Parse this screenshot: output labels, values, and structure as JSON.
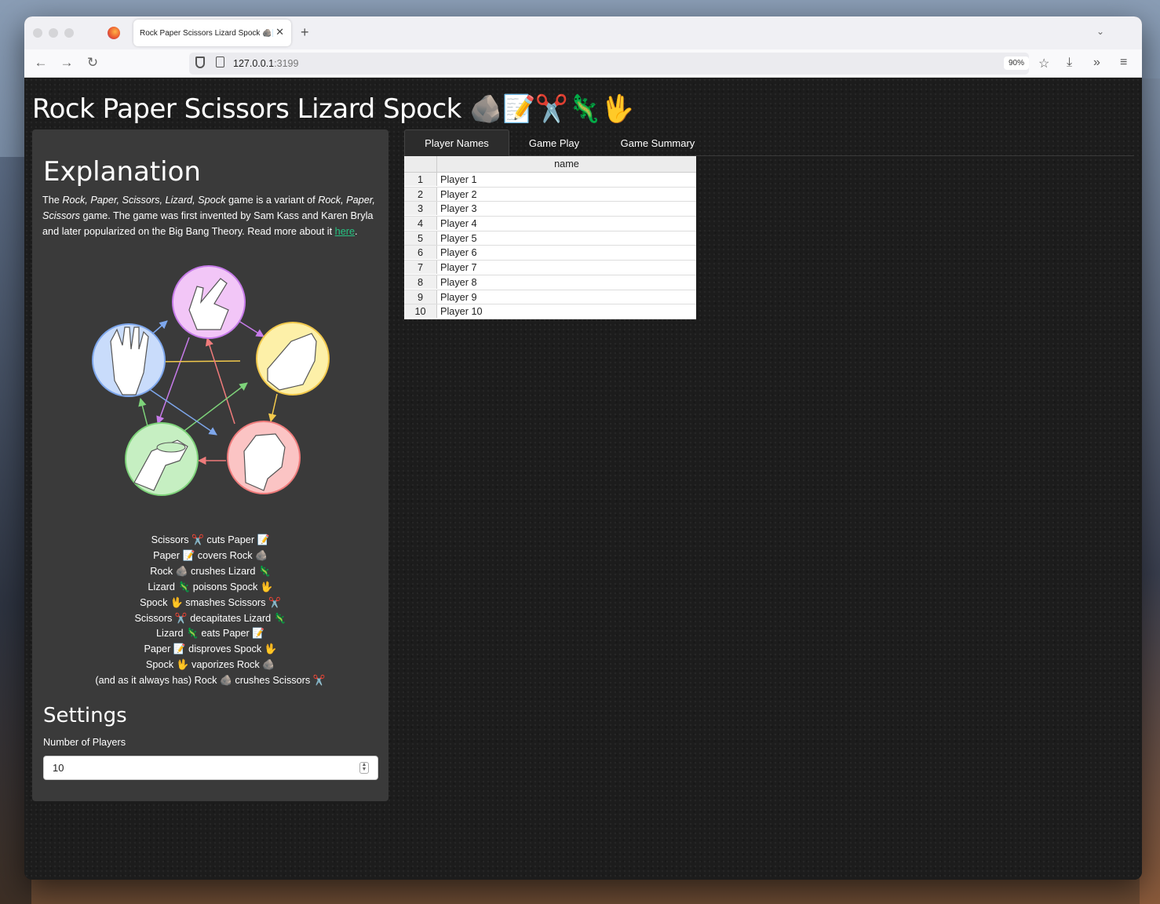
{
  "browser": {
    "tab_title": "Rock Paper Scissors Lizard Spock 🪨📝✂️🦎🖖",
    "new_tab": "+",
    "url_host": "127.0.0.1",
    "url_port": ":3199",
    "zoom": "90%"
  },
  "page": {
    "title": "Rock Paper Scissors Lizard Spock 🪨📝✂️🦎🖖"
  },
  "sidebar": {
    "heading": "Explanation",
    "intro_1": "The ",
    "intro_italic_1": "Rock, Paper, Scissors, Lizard, Spock",
    "intro_2": " game is a variant of ",
    "intro_italic_2": "Rock, Paper, Scissors",
    "intro_3": " game. The game was first invented by Sam Kass and Karen Bryla and later popularized on the Big Bang Theory. Read more about it ",
    "link_text": "here",
    "intro_4": ".",
    "rules": [
      "Scissors ✂️ cuts Paper 📝",
      "Paper 📝 covers Rock 🪨",
      "Rock 🪨 crushes Lizard 🦎",
      "Lizard 🦎 poisons Spock 🖖",
      "Spock 🖖 smashes Scissors ✂️",
      "Scissors ✂️ decapitates Lizard 🦎",
      "Lizard 🦎 eats Paper 📝",
      "Paper 📝 disproves Spock 🖖",
      "Spock 🖖 vaporizes Rock 🪨",
      "(and as it always has) Rock 🪨 crushes Scissors ✂️"
    ],
    "settings_heading": "Settings",
    "num_players_label": "Number of Players",
    "num_players_value": "10"
  },
  "tabs": [
    {
      "label": "Player Names",
      "active": true
    },
    {
      "label": "Game Play",
      "active": false
    },
    {
      "label": "Game Summary",
      "active": false
    }
  ],
  "table": {
    "column": "name",
    "rows": [
      {
        "idx": "1",
        "name": "Player 1"
      },
      {
        "idx": "2",
        "name": "Player 2"
      },
      {
        "idx": "3",
        "name": "Player 3"
      },
      {
        "idx": "4",
        "name": "Player 4"
      },
      {
        "idx": "5",
        "name": "Player 5"
      },
      {
        "idx": "6",
        "name": "Player 6"
      },
      {
        "idx": "7",
        "name": "Player 7"
      },
      {
        "idx": "8",
        "name": "Player 8"
      },
      {
        "idx": "9",
        "name": "Player 9"
      },
      {
        "idx": "10",
        "name": "Player 10"
      }
    ]
  },
  "diagram_colors": {
    "scissors": "#f2c6f7",
    "paper": "#fdf0a8",
    "rock": "#fbc4c4",
    "lizard": "#c6efc2",
    "spock": "#c9dcfb"
  }
}
